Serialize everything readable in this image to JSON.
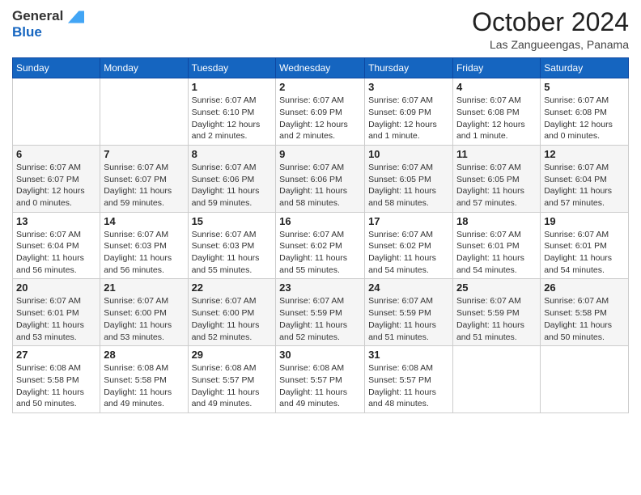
{
  "header": {
    "logo_line1": "General",
    "logo_line2": "Blue",
    "month": "October 2024",
    "location": "Las Zangueengas, Panama"
  },
  "weekdays": [
    "Sunday",
    "Monday",
    "Tuesday",
    "Wednesday",
    "Thursday",
    "Friday",
    "Saturday"
  ],
  "weeks": [
    [
      {
        "day": "",
        "info": ""
      },
      {
        "day": "",
        "info": ""
      },
      {
        "day": "1",
        "info": "Sunrise: 6:07 AM\nSunset: 6:10 PM\nDaylight: 12 hours\nand 2 minutes."
      },
      {
        "day": "2",
        "info": "Sunrise: 6:07 AM\nSunset: 6:09 PM\nDaylight: 12 hours\nand 2 minutes."
      },
      {
        "day": "3",
        "info": "Sunrise: 6:07 AM\nSunset: 6:09 PM\nDaylight: 12 hours\nand 1 minute."
      },
      {
        "day": "4",
        "info": "Sunrise: 6:07 AM\nSunset: 6:08 PM\nDaylight: 12 hours\nand 1 minute."
      },
      {
        "day": "5",
        "info": "Sunrise: 6:07 AM\nSunset: 6:08 PM\nDaylight: 12 hours\nand 0 minutes."
      }
    ],
    [
      {
        "day": "6",
        "info": "Sunrise: 6:07 AM\nSunset: 6:07 PM\nDaylight: 12 hours\nand 0 minutes."
      },
      {
        "day": "7",
        "info": "Sunrise: 6:07 AM\nSunset: 6:07 PM\nDaylight: 11 hours\nand 59 minutes."
      },
      {
        "day": "8",
        "info": "Sunrise: 6:07 AM\nSunset: 6:06 PM\nDaylight: 11 hours\nand 59 minutes."
      },
      {
        "day": "9",
        "info": "Sunrise: 6:07 AM\nSunset: 6:06 PM\nDaylight: 11 hours\nand 58 minutes."
      },
      {
        "day": "10",
        "info": "Sunrise: 6:07 AM\nSunset: 6:05 PM\nDaylight: 11 hours\nand 58 minutes."
      },
      {
        "day": "11",
        "info": "Sunrise: 6:07 AM\nSunset: 6:05 PM\nDaylight: 11 hours\nand 57 minutes."
      },
      {
        "day": "12",
        "info": "Sunrise: 6:07 AM\nSunset: 6:04 PM\nDaylight: 11 hours\nand 57 minutes."
      }
    ],
    [
      {
        "day": "13",
        "info": "Sunrise: 6:07 AM\nSunset: 6:04 PM\nDaylight: 11 hours\nand 56 minutes."
      },
      {
        "day": "14",
        "info": "Sunrise: 6:07 AM\nSunset: 6:03 PM\nDaylight: 11 hours\nand 56 minutes."
      },
      {
        "day": "15",
        "info": "Sunrise: 6:07 AM\nSunset: 6:03 PM\nDaylight: 11 hours\nand 55 minutes."
      },
      {
        "day": "16",
        "info": "Sunrise: 6:07 AM\nSunset: 6:02 PM\nDaylight: 11 hours\nand 55 minutes."
      },
      {
        "day": "17",
        "info": "Sunrise: 6:07 AM\nSunset: 6:02 PM\nDaylight: 11 hours\nand 54 minutes."
      },
      {
        "day": "18",
        "info": "Sunrise: 6:07 AM\nSunset: 6:01 PM\nDaylight: 11 hours\nand 54 minutes."
      },
      {
        "day": "19",
        "info": "Sunrise: 6:07 AM\nSunset: 6:01 PM\nDaylight: 11 hours\nand 54 minutes."
      }
    ],
    [
      {
        "day": "20",
        "info": "Sunrise: 6:07 AM\nSunset: 6:01 PM\nDaylight: 11 hours\nand 53 minutes."
      },
      {
        "day": "21",
        "info": "Sunrise: 6:07 AM\nSunset: 6:00 PM\nDaylight: 11 hours\nand 53 minutes."
      },
      {
        "day": "22",
        "info": "Sunrise: 6:07 AM\nSunset: 6:00 PM\nDaylight: 11 hours\nand 52 minutes."
      },
      {
        "day": "23",
        "info": "Sunrise: 6:07 AM\nSunset: 5:59 PM\nDaylight: 11 hours\nand 52 minutes."
      },
      {
        "day": "24",
        "info": "Sunrise: 6:07 AM\nSunset: 5:59 PM\nDaylight: 11 hours\nand 51 minutes."
      },
      {
        "day": "25",
        "info": "Sunrise: 6:07 AM\nSunset: 5:59 PM\nDaylight: 11 hours\nand 51 minutes."
      },
      {
        "day": "26",
        "info": "Sunrise: 6:07 AM\nSunset: 5:58 PM\nDaylight: 11 hours\nand 50 minutes."
      }
    ],
    [
      {
        "day": "27",
        "info": "Sunrise: 6:08 AM\nSunset: 5:58 PM\nDaylight: 11 hours\nand 50 minutes."
      },
      {
        "day": "28",
        "info": "Sunrise: 6:08 AM\nSunset: 5:58 PM\nDaylight: 11 hours\nand 49 minutes."
      },
      {
        "day": "29",
        "info": "Sunrise: 6:08 AM\nSunset: 5:57 PM\nDaylight: 11 hours\nand 49 minutes."
      },
      {
        "day": "30",
        "info": "Sunrise: 6:08 AM\nSunset: 5:57 PM\nDaylight: 11 hours\nand 49 minutes."
      },
      {
        "day": "31",
        "info": "Sunrise: 6:08 AM\nSunset: 5:57 PM\nDaylight: 11 hours\nand 48 minutes."
      },
      {
        "day": "",
        "info": ""
      },
      {
        "day": "",
        "info": ""
      }
    ]
  ]
}
